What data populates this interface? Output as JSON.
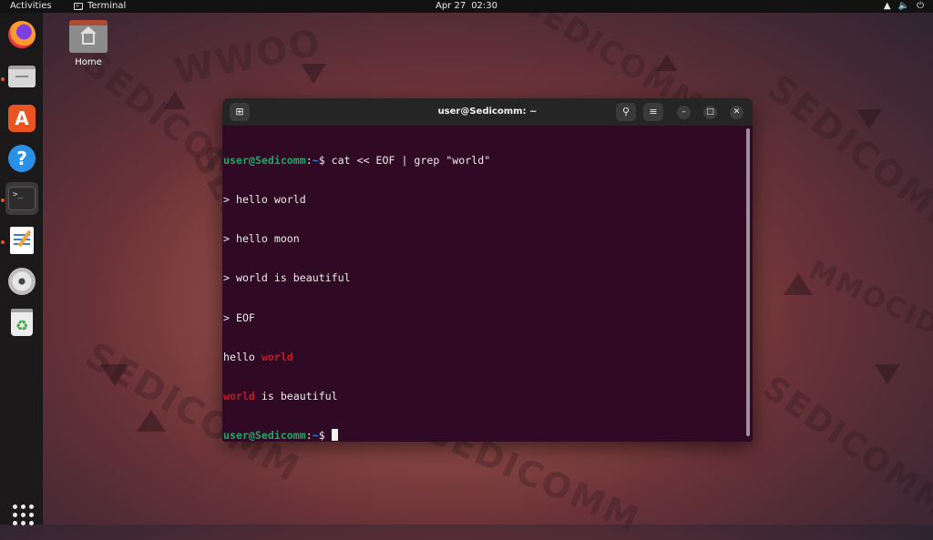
{
  "topbar": {
    "activities": "Activities",
    "app_name": "Terminal",
    "app_icon": "terminal-icon",
    "date": "Apr 27",
    "time": "02:30",
    "sys_icons": [
      "network-icon",
      "volume-icon",
      "power-icon"
    ]
  },
  "dock": {
    "items": [
      {
        "name": "firefox",
        "icon": "firefox-icon",
        "running": false
      },
      {
        "name": "files",
        "icon": "files-icon",
        "running": true
      },
      {
        "name": "app-center",
        "icon": "app-center-icon",
        "running": false
      },
      {
        "name": "help",
        "icon": "help-icon",
        "running": false
      },
      {
        "name": "terminal",
        "icon": "terminal-icon",
        "running": true,
        "active": true
      },
      {
        "name": "text-editor",
        "icon": "text-editor-icon",
        "running": true
      },
      {
        "name": "disc",
        "icon": "disc-icon",
        "running": false
      },
      {
        "name": "trash",
        "icon": "trash-icon",
        "running": false
      }
    ],
    "show_apps_icon": "app-grid-icon"
  },
  "desktop": {
    "home_label": "Home"
  },
  "window": {
    "title": "user@Sedicomm: ~",
    "lines": [
      {
        "type": "prompt",
        "user": "user@Sedicomm",
        "sep": ":",
        "path": "~",
        "symbol": "$",
        "cmd": " cat << EOF | grep \"world\""
      },
      {
        "type": "text",
        "text": "> hello world"
      },
      {
        "type": "text",
        "text": "> hello moon"
      },
      {
        "type": "text",
        "text": "> world is beautiful"
      },
      {
        "type": "text",
        "text": "> EOF"
      },
      {
        "type": "match",
        "before": "hello ",
        "match": "world",
        "after": ""
      },
      {
        "type": "match",
        "before": "",
        "match": "world",
        "after": " is beautiful"
      },
      {
        "type": "prompt",
        "user": "user@Sedicomm",
        "sep": ":",
        "path": "~",
        "symbol": "$",
        "cmd": " "
      }
    ]
  },
  "colors": {
    "terminal_bg": "#300a24",
    "prompt_user": "#26a269",
    "prompt_path": "#3a7bd5",
    "grep_match": "#c01c28",
    "accent": "#e95420"
  },
  "wallpaper": {
    "watermark": [
      "SEDICOMM",
      "MMOCIDES",
      "WWOO"
    ]
  }
}
